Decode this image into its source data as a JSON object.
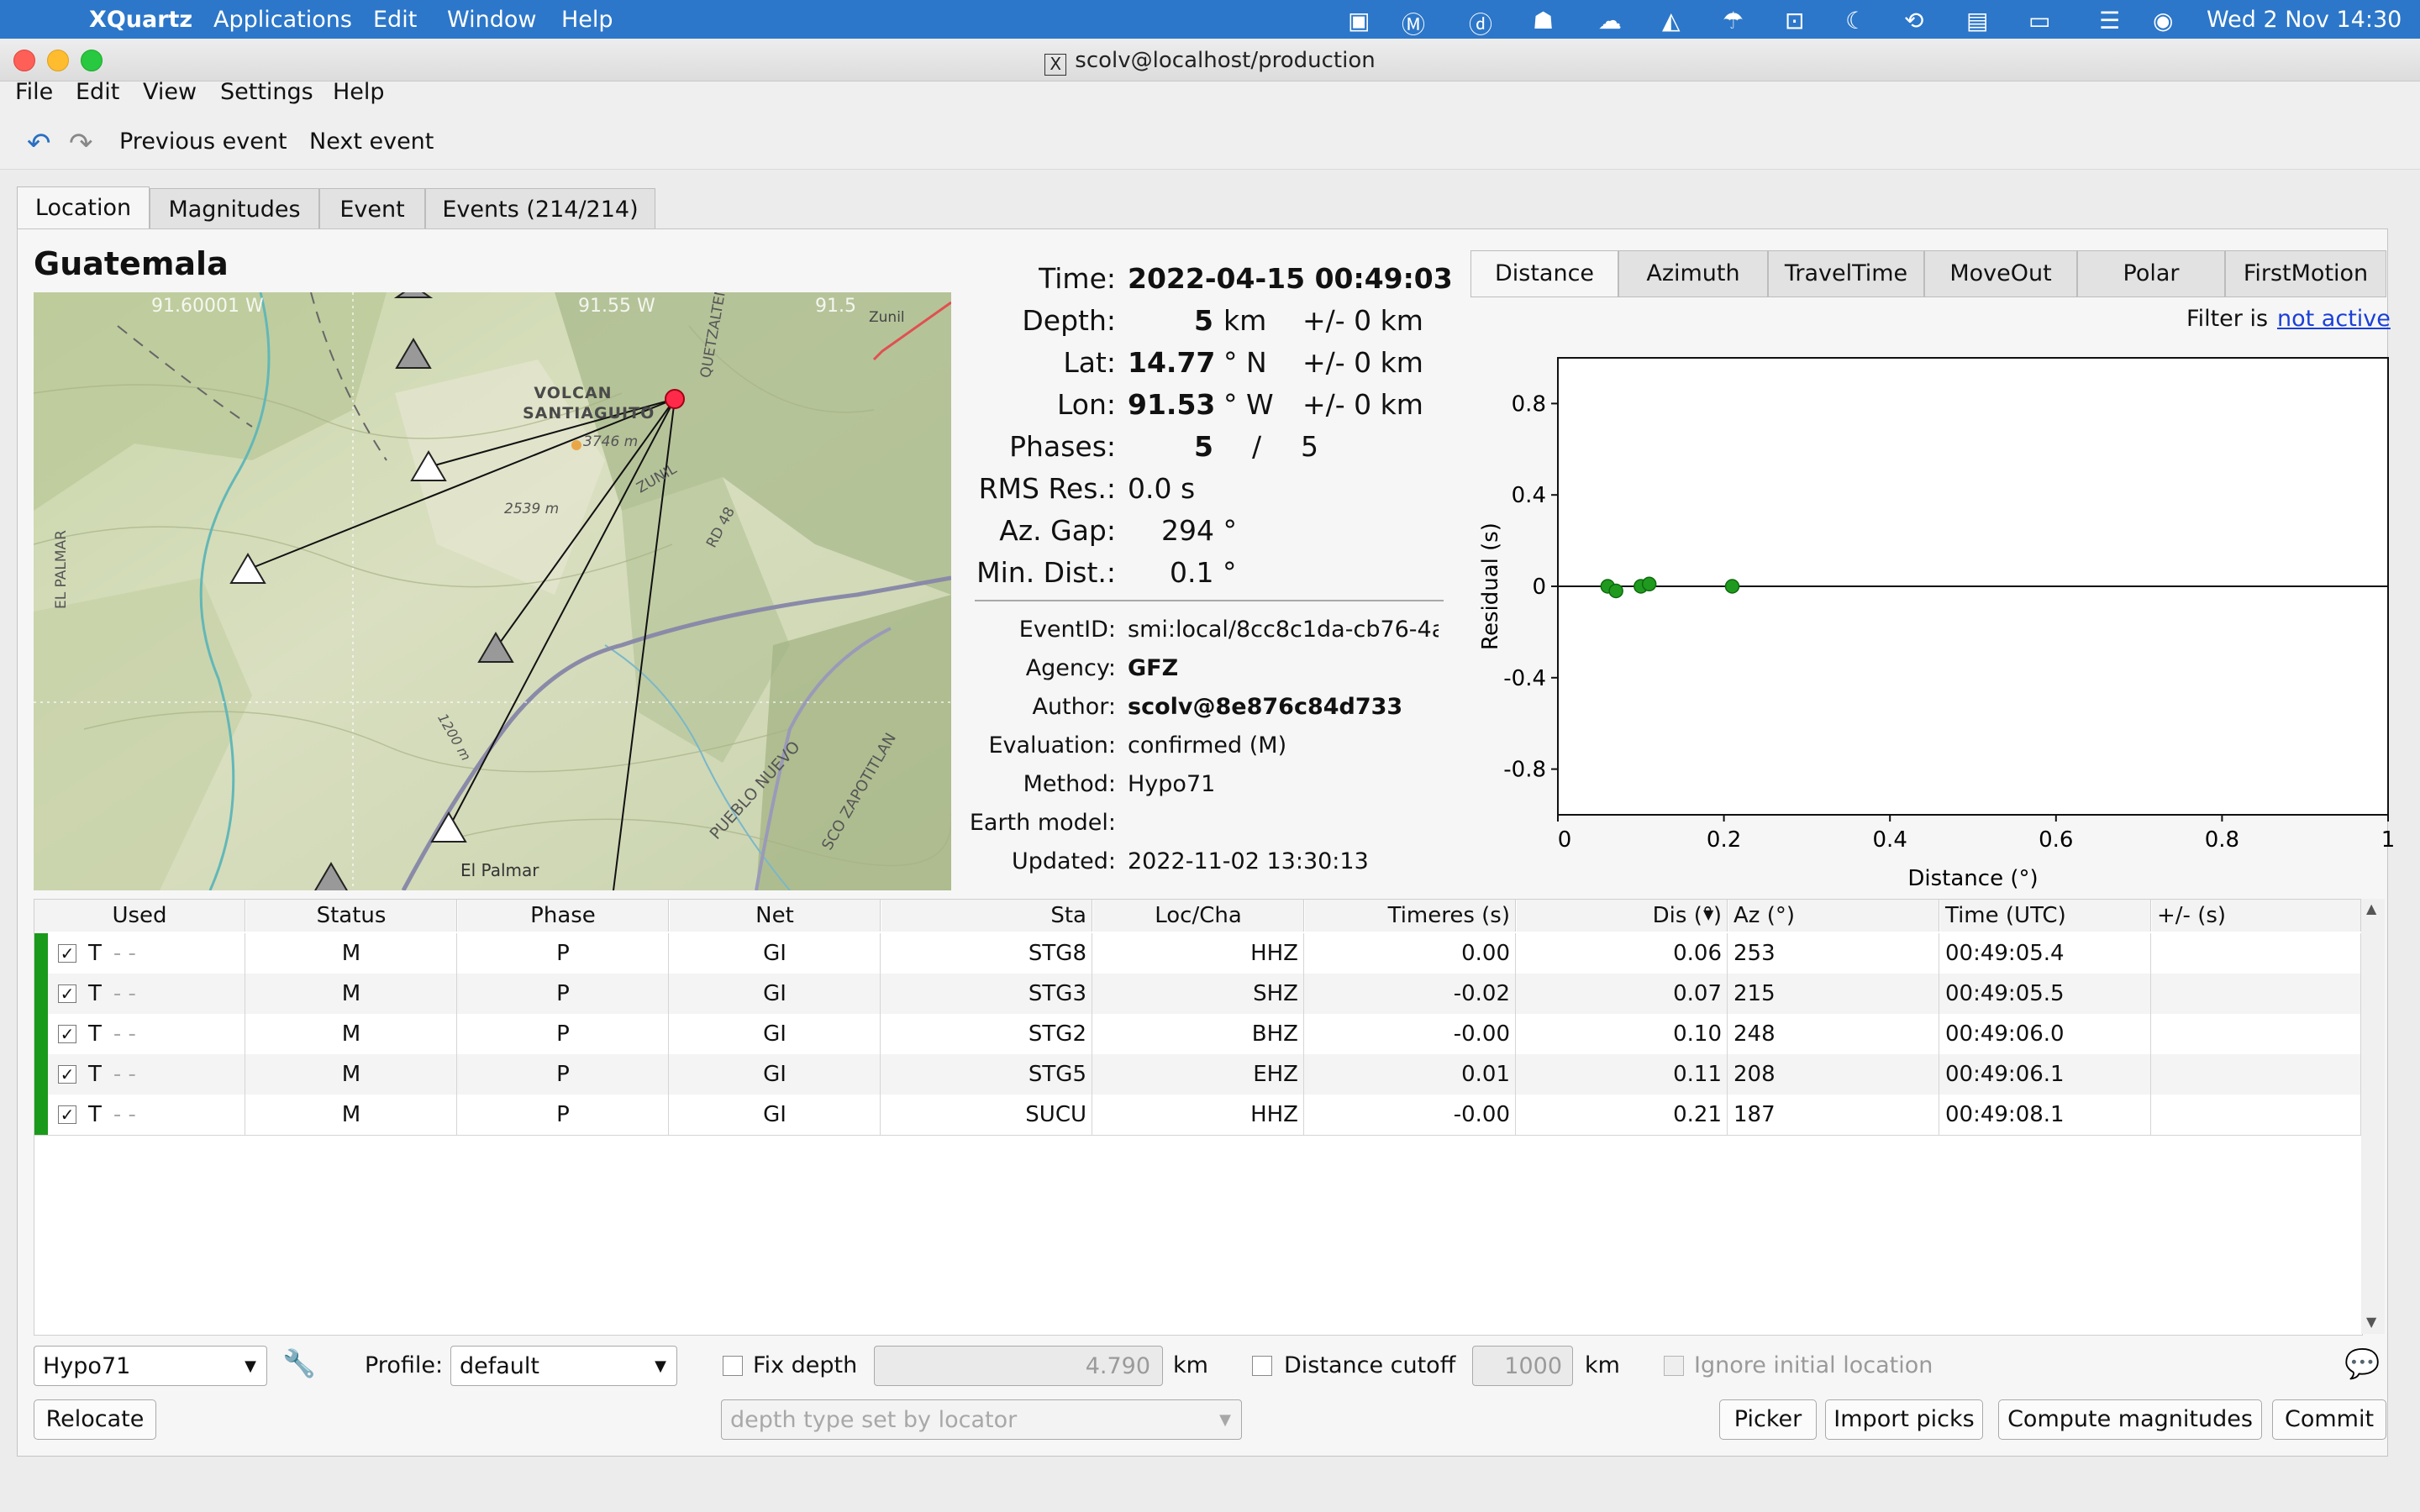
{
  "macos": {
    "app": "XQuartz",
    "menus": [
      "Applications",
      "Edit",
      "Window",
      "Help"
    ],
    "clock": "Wed 2 Nov  14:30"
  },
  "window": {
    "title": "scolv@localhost/production",
    "menu": [
      "File",
      "Edit",
      "View",
      "Settings",
      "Help"
    ],
    "toolbar": {
      "prev": "Previous event",
      "next": "Next event"
    }
  },
  "tabs": [
    "Location",
    "Magnitudes",
    "Event",
    "Events (214/214)"
  ],
  "region": "Guatemala",
  "map": {
    "volcano_label": "VOLCAN SANTIAGUITO",
    "elev1": "3746 m",
    "elev2": "2539 m",
    "place1": "El Palmar",
    "side_label": "EL PALMAR",
    "road1": "PUEBLO NUEVO",
    "road2": "SCO ZAPOTITLAN",
    "town": "Zunil",
    "town_label": "ZUNIL",
    "river": "QUETZALTENANG",
    "coord1": "91.60001 W",
    "coord2": "91.55 W",
    "coord3": "91.5",
    "contour": "1200 m",
    "rd": "RD 48"
  },
  "origin": {
    "time_label": "Time:",
    "time": "2022-04-15 00:49:03",
    "depth_label": "Depth:",
    "depth": "5",
    "depth_unit": "km",
    "depth_err": "+/- 0  km",
    "lat_label": "Lat:",
    "lat": "14.77",
    "lat_unit": "° N",
    "lat_err": "+/- 0  km",
    "lon_label": "Lon:",
    "lon": "91.53",
    "lon_unit": "° W",
    "lon_err": "+/- 0  km",
    "phases_label": "Phases:",
    "phases_used": "5",
    "phases_sep": "/",
    "phases_total": "5",
    "rms_label": "RMS Res.:",
    "rms": "0.0  s",
    "gap_label": "Az. Gap:",
    "gap": "294  °",
    "mindist_label": "Min. Dist.:",
    "mindist": "0.1  °"
  },
  "event": {
    "id_label": "EventID:",
    "id": "smi:local/8cc8c1da-cb76-4a",
    "agency_label": "Agency:",
    "agency": "GFZ",
    "author_label": "Author:",
    "author": "scolv@8e876c84d733",
    "eval_label": "Evaluation:",
    "eval": "confirmed (M)",
    "method_label": "Method:",
    "method": "Hypo71",
    "model_label": "Earth model:",
    "model": "",
    "updated_label": "Updated:",
    "updated": "2022-11-02 13:30:13"
  },
  "plot_tabs": [
    "Distance",
    "Azimuth",
    "TravelTime",
    "MoveOut",
    "Polar",
    "FirstMotion"
  ],
  "filter": {
    "label": "Filter is",
    "link": "not active"
  },
  "chart_data": {
    "type": "scatter",
    "xlabel": "Distance (°)",
    "ylabel": "Residual (s)",
    "xlim": [
      0,
      1
    ],
    "ylim": [
      -1,
      1
    ],
    "xticks": [
      "0",
      "0.2",
      "0.4",
      "0.6",
      "0.8",
      "1"
    ],
    "yticks": [
      "0.8",
      "0.4",
      "0",
      "-0.4",
      "-0.8"
    ],
    "grid": true,
    "points": [
      {
        "x": 0.06,
        "y": 0.0
      },
      {
        "x": 0.07,
        "y": -0.02
      },
      {
        "x": 0.1,
        "y": -0.0
      },
      {
        "x": 0.11,
        "y": 0.01
      },
      {
        "x": 0.21,
        "y": -0.0
      }
    ]
  },
  "table": {
    "headers": [
      "Used",
      "Status",
      "Phase",
      "Net",
      "Sta",
      "Loc/Cha",
      "Timeres (s)",
      "Dis (°)",
      "Az (°)",
      "Time (UTC)",
      "+/- (s)"
    ],
    "rows": [
      {
        "used": "T",
        "flag": "-  -",
        "status": "M",
        "phase": "P",
        "net": "GI",
        "sta": "STG8",
        "cha": "HHZ",
        "res": "0.00",
        "dis": "0.06",
        "az": "253",
        "time": "00:49:05.4",
        "err": ""
      },
      {
        "used": "T",
        "flag": "-  -",
        "status": "M",
        "phase": "P",
        "net": "GI",
        "sta": "STG3",
        "cha": "SHZ",
        "res": "-0.02",
        "dis": "0.07",
        "az": "215",
        "time": "00:49:05.5",
        "err": ""
      },
      {
        "used": "T",
        "flag": "-  -",
        "status": "M",
        "phase": "P",
        "net": "GI",
        "sta": "STG2",
        "cha": "BHZ",
        "res": "-0.00",
        "dis": "0.10",
        "az": "248",
        "time": "00:49:06.0",
        "err": ""
      },
      {
        "used": "T",
        "flag": "-  -",
        "status": "M",
        "phase": "P",
        "net": "GI",
        "sta": "STG5",
        "cha": "EHZ",
        "res": "0.01",
        "dis": "0.11",
        "az": "208",
        "time": "00:49:06.1",
        "err": ""
      },
      {
        "used": "T",
        "flag": "-  -",
        "status": "M",
        "phase": "P",
        "net": "GI",
        "sta": "SUCU",
        "cha": "HHZ",
        "res": "-0.00",
        "dis": "0.21",
        "az": "187",
        "time": "00:49:08.1",
        "err": ""
      }
    ]
  },
  "controls": {
    "locator": "Hypo71",
    "profile_label": "Profile:",
    "profile": "default",
    "fix_depth_label": "Fix depth",
    "depth_value": "4.790",
    "km1": "km",
    "cutoff_label": "Distance cutoff",
    "cutoff_value": "1000",
    "km2": "km",
    "ignore_label": "Ignore initial location",
    "depth_type": "depth type set by locator",
    "relocate": "Relocate",
    "picker": "Picker",
    "import": "Import picks",
    "compute": "Compute magnitudes",
    "commit": "Commit"
  },
  "colors": {
    "accent": "#2c77c9",
    "used": "#1a9a1a",
    "point": "#1f9a1f",
    "event": "#ff2a4a"
  }
}
